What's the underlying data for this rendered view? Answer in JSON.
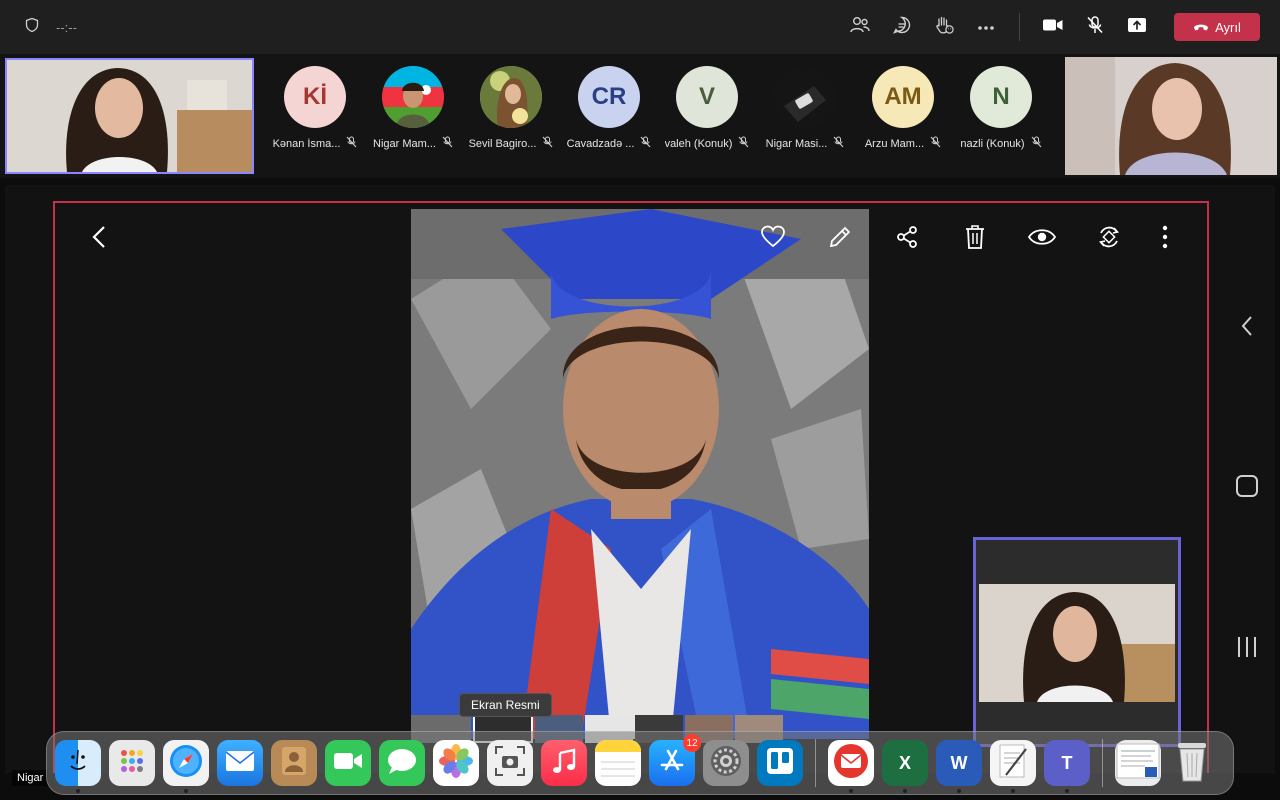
{
  "meeting": {
    "timer": "--:--",
    "leave_label": "Ayrıl"
  },
  "participants": [
    {
      "initials": "Kİ",
      "name": "Kənan İsma...",
      "avatar_color": "#f4d5d3",
      "text_color": "#a4372f"
    },
    {
      "initials": "",
      "name": "Nigar Mam...",
      "avatar_color": "#3f5b33",
      "text_color": "#ffffff"
    },
    {
      "initials": "",
      "name": "Sevil Bagiro...",
      "avatar_color": "#d8c49b",
      "text_color": "#ffffff"
    },
    {
      "initials": "CR",
      "name": "Cavadzadə ...",
      "avatar_color": "#c9d3ef",
      "text_color": "#2a3f86"
    },
    {
      "initials": "V",
      "name": "valeh (Konuk)",
      "avatar_color": "#dfe5d8",
      "text_color": "#4a5b3e"
    },
    {
      "initials": "",
      "name": "Nigar Masi...",
      "avatar_color": "#202020",
      "text_color": "#ffffff"
    },
    {
      "initials": "AM",
      "name": "Arzu Mam...",
      "avatar_color": "#f7e8b8",
      "text_color": "#7a5a12"
    },
    {
      "initials": "N",
      "name": "nazli (Konuk)",
      "avatar_color": "#e1ead9",
      "text_color": "#3f5f38"
    }
  ],
  "share": {
    "tooltip": "Ekran Resmi"
  },
  "bottom_label": "Nigar",
  "dock": {
    "appstore_badge": "12",
    "excel_letter": "X",
    "word_letter": "W",
    "teams_letter": "T"
  },
  "colors": {
    "accent_purple": "#8a86ff",
    "leave_red": "#c4314b",
    "share_border": "#c4314b"
  }
}
